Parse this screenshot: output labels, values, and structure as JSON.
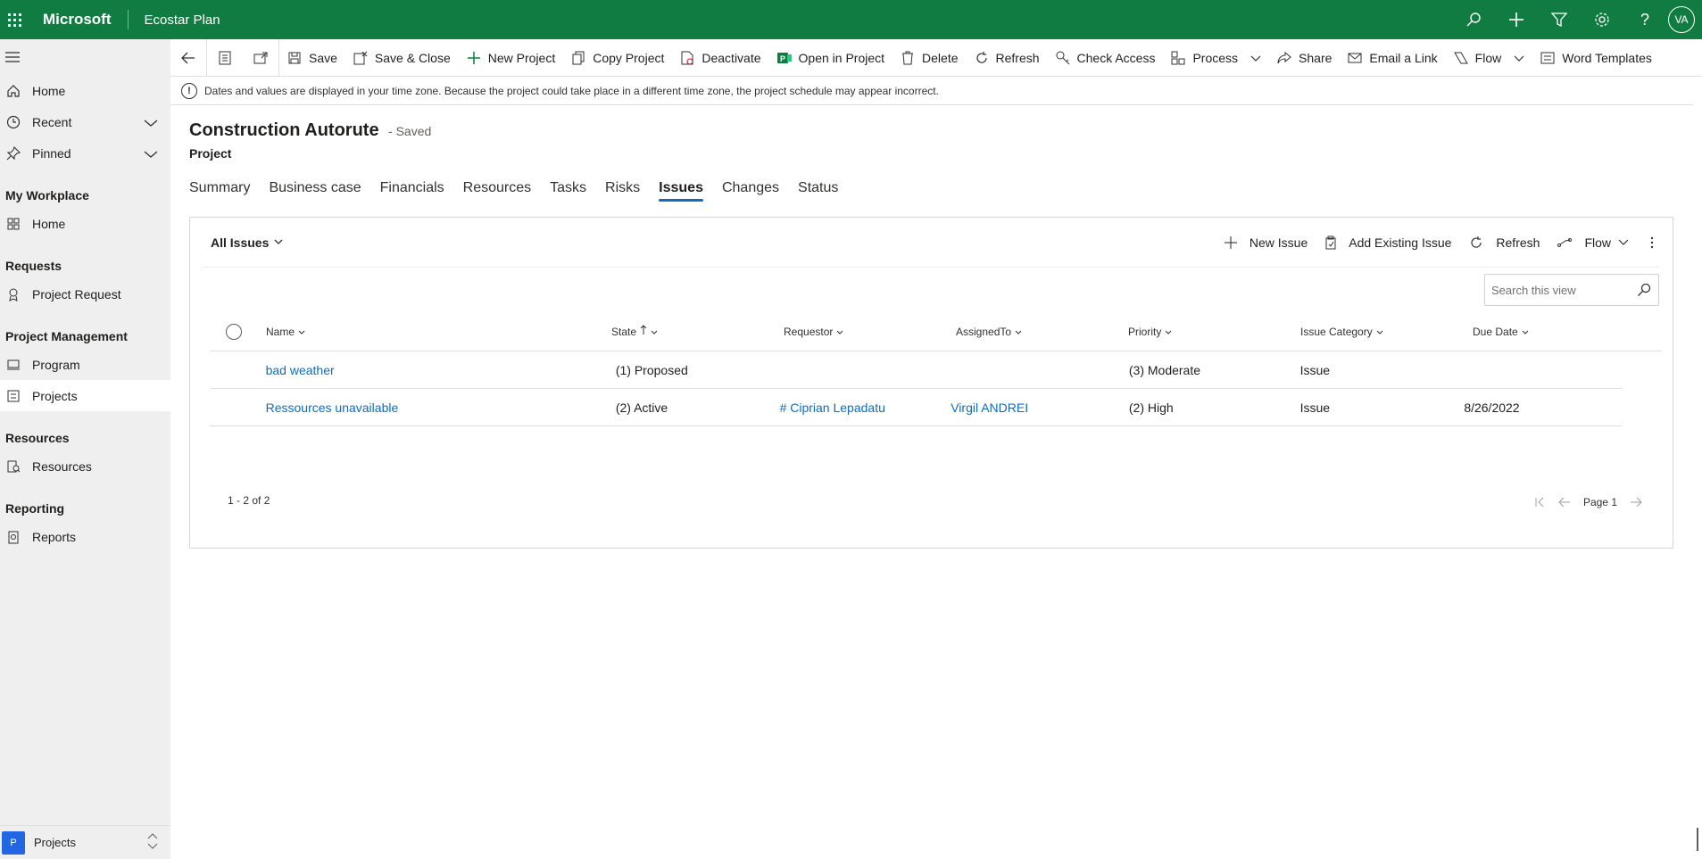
{
  "topbar": {
    "brand": "Microsoft",
    "app_name": "Ecostar Plan",
    "avatar_initials": "VA",
    "bg_color": "#107c41"
  },
  "sidebar": {
    "items_top": [
      {
        "label": "Home",
        "icon": "home-icon"
      },
      {
        "label": "Recent",
        "icon": "clock-icon",
        "expandable": true
      },
      {
        "label": "Pinned",
        "icon": "pin-icon",
        "expandable": true
      }
    ],
    "groups": [
      {
        "title": "My Workplace",
        "items": [
          {
            "label": "Home",
            "icon": "dashboard-icon"
          }
        ]
      },
      {
        "title": "Requests",
        "items": [
          {
            "label": "Project Request",
            "icon": "request-icon"
          }
        ]
      },
      {
        "title": "Project Management",
        "items": [
          {
            "label": "Program",
            "icon": "program-icon"
          },
          {
            "label": "Projects",
            "icon": "projects-icon",
            "active": true
          }
        ]
      },
      {
        "title": "Resources",
        "items": [
          {
            "label": "Resources",
            "icon": "resources-icon"
          }
        ]
      },
      {
        "title": "Reporting",
        "items": [
          {
            "label": "Reports",
            "icon": "reports-icon"
          }
        ]
      }
    ],
    "area": {
      "badge": "P",
      "name": "Projects"
    }
  },
  "commandbar": {
    "save": "Save",
    "save_close": "Save & Close",
    "new_project": "New Project",
    "copy_project": "Copy Project",
    "deactivate": "Deactivate",
    "open_in_project": "Open in Project",
    "delete": "Delete",
    "refresh": "Refresh",
    "check_access": "Check Access",
    "process": "Process",
    "share": "Share",
    "email_link": "Email a Link",
    "flow": "Flow",
    "word_templates": "Word Templates"
  },
  "notification": {
    "text": "Dates and values are displayed in your time zone. Because the project could take place in a different time zone, the project schedule may appear incorrect."
  },
  "record": {
    "title": "Construction Autorute",
    "saved_status": "- Saved",
    "entity": "Project"
  },
  "tabs": [
    "Summary",
    "Business case",
    "Financials",
    "Resources",
    "Tasks",
    "Risks",
    "Issues",
    "Changes",
    "Status"
  ],
  "active_tab": "Issues",
  "subgrid": {
    "view_name": "All Issues",
    "new_issue": "New Issue",
    "add_existing": "Add Existing Issue",
    "refresh": "Refresh",
    "flow": "Flow",
    "search_placeholder": "Search this view",
    "columns": {
      "name": "Name",
      "state": "State",
      "requestor": "Requestor",
      "assigned_to": "AssignedTo",
      "priority": "Priority",
      "category": "Issue Category",
      "due_date": "Due Date"
    },
    "rows": [
      {
        "name": "bad weather",
        "state": "(1) Proposed",
        "requestor": "",
        "assigned_to": "",
        "priority": "(3) Moderate",
        "category": "Issue",
        "due_date": ""
      },
      {
        "name": "Ressources unavailable",
        "state": "(2) Active",
        "requestor": "# Ciprian Lepadatu",
        "assigned_to": "Virgil ANDREI",
        "priority": "(2) High",
        "category": "Issue",
        "due_date": "8/26/2022"
      }
    ],
    "record_count": "1 - 2 of 2",
    "page_label": "Page 1"
  },
  "colors": {
    "accent": "#0f6cbd",
    "link": "#0f6cbd"
  }
}
